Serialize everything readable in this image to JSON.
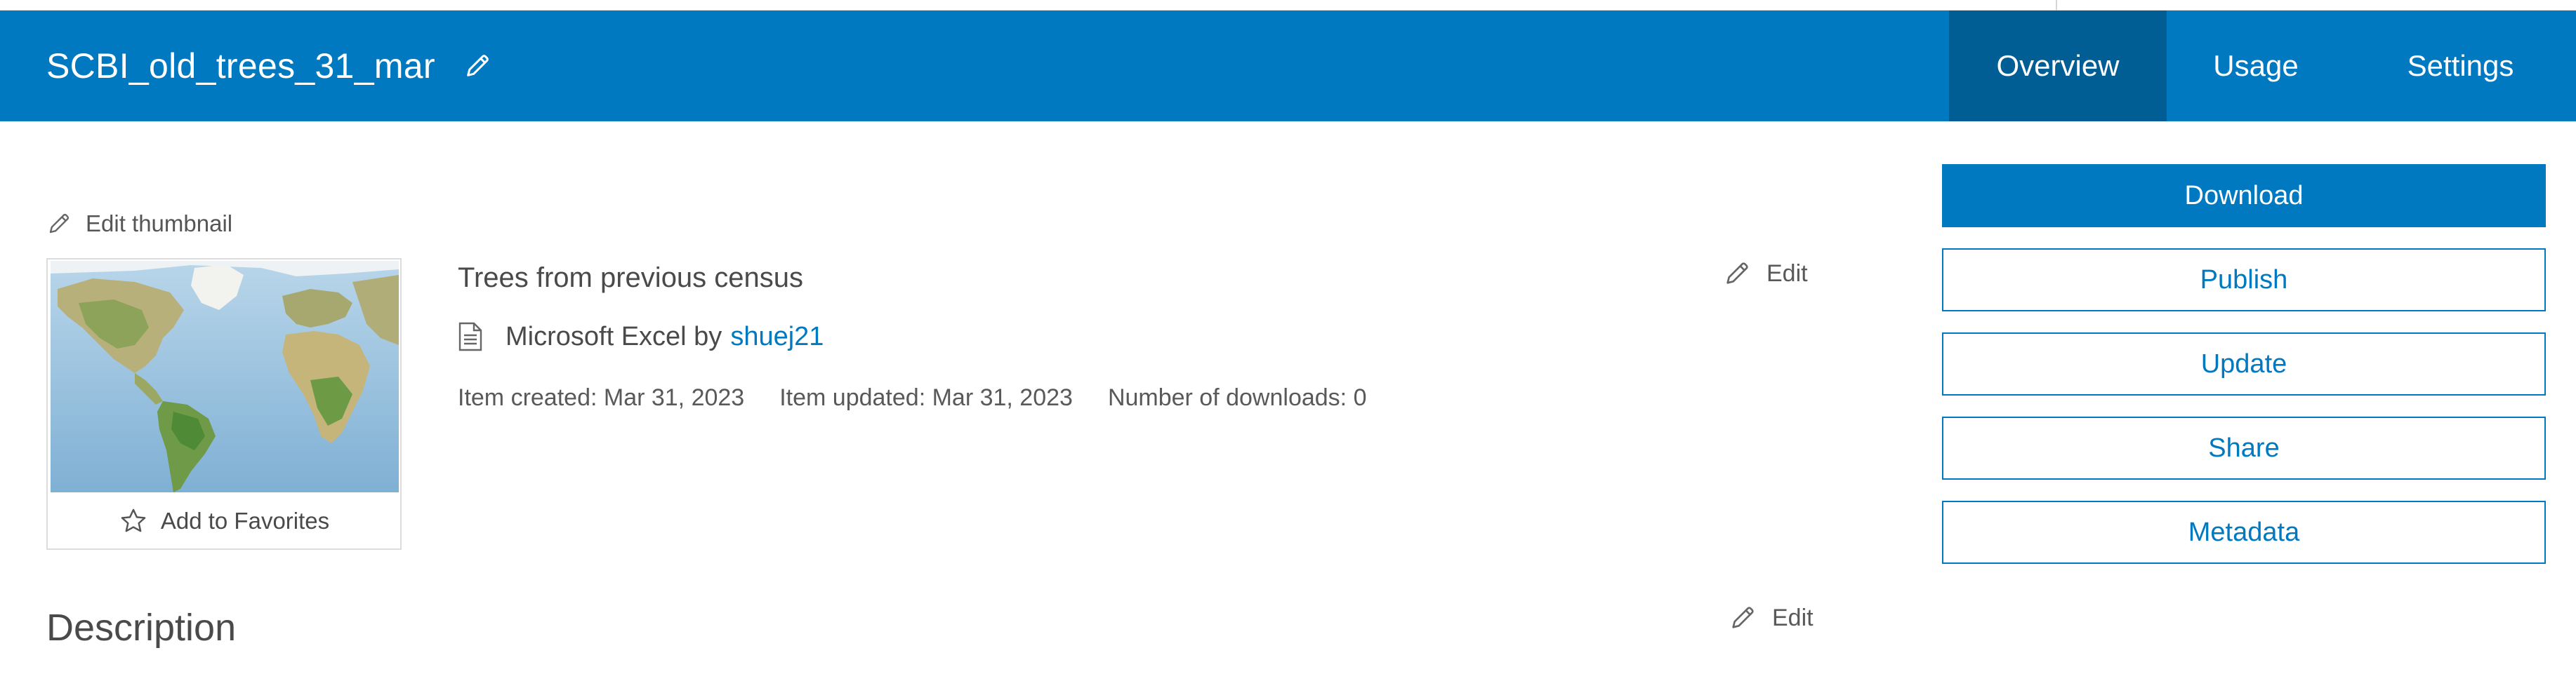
{
  "header": {
    "title": "SCBI_old_trees_31_mar",
    "edit_title_icon": "pencil-icon",
    "tabs": [
      {
        "label": "Overview",
        "active": true
      },
      {
        "label": "Usage",
        "active": false
      },
      {
        "label": "Settings",
        "active": false
      }
    ]
  },
  "colors": {
    "brand": "#0079c1",
    "active_tab": "#005e95",
    "link": "#0079c1"
  },
  "thumbnail": {
    "edit_label": "Edit thumbnail",
    "favorite_label": "Add to Favorites",
    "favorite_icon": "star-icon"
  },
  "item": {
    "summary": "Trees from previous census",
    "type_prefix": "Microsoft Excel by",
    "owner": "shuej21",
    "type_icon": "document-icon",
    "created": "Item created: Mar 31, 2023",
    "updated": "Item updated: Mar 31, 2023",
    "downloads": "Number of downloads: 0",
    "edit_label": "Edit"
  },
  "description": {
    "heading": "Description",
    "edit_label": "Edit"
  },
  "actions": {
    "download": "Download",
    "publish": "Publish",
    "update": "Update",
    "share": "Share",
    "metadata": "Metadata"
  }
}
